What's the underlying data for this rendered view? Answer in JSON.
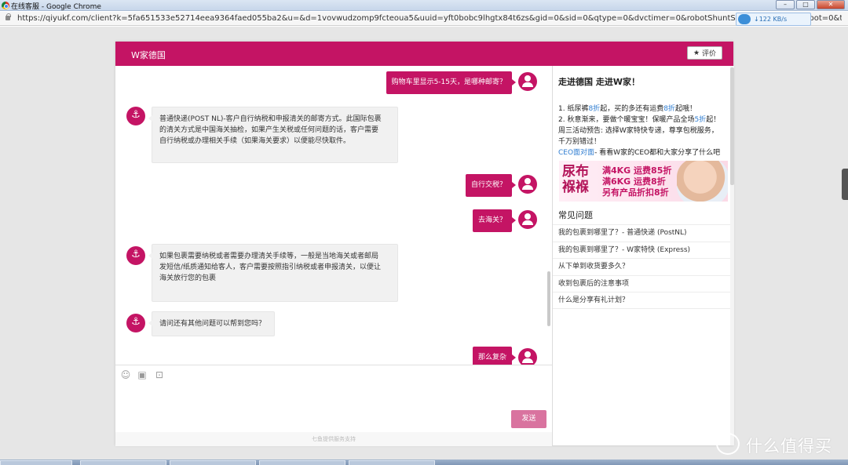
{
  "window": {
    "title": "在线客服 - Google Chrome"
  },
  "browser": {
    "url": "https://qiyukf.com/client?k=5fa651533e52714eea9364faed055ba2&u=&d=1vovwudzomp9fcteoua5&uuid=yft0bobc9lhgtx84t6zs&gid=0&sid=0&qtype=0&dvctimer=0&robotShuntSwitch=0&hc=0&robot=0&t=1540431...",
    "net_speed": "↓122 KB/s"
  },
  "header": {
    "brand": "W家德国",
    "rate_label": "评价"
  },
  "chat": {
    "messages": [
      {
        "from": "user",
        "text": "购物车里显示5-15天，是哪种邮寄？"
      },
      {
        "from": "agent",
        "lines": [
          "普通快递(POST NL)-客户自行纳税和申报清关的邮寄方式。此国际包裹",
          "的清关方式是中国海关抽检，如果产生关税或任何问题的话，客户需要",
          "自行纳税或办理相关手续（如果海关要求）以便能尽快取件。"
        ]
      },
      {
        "from": "user",
        "text": "自行交税？"
      },
      {
        "from": "user",
        "text": "去海关？"
      },
      {
        "from": "agent",
        "lines": [
          "如果包裹需要纳税或者需要办理清关手续等，一般是当地海关或者邮局",
          "发短信/纸质通知给客人，客户需要按照指引纳税或者申报清关，以便让",
          "海关放行您的包裹"
        ]
      },
      {
        "from": "agent",
        "lines": [
          "请问还有其他问题可以帮到您吗？"
        ]
      },
      {
        "from": "user",
        "text": "那么复杂"
      }
    ]
  },
  "input": {
    "send_label": "发送",
    "powered_by": "七鱼提供服务支持"
  },
  "panel": {
    "title": "走进德国 走进W家！",
    "promo": {
      "line1_a": "1. 纸尿裤",
      "line1_b": "8折",
      "line1_c": "起，买的多还有运费",
      "line1_d": "8折",
      "line1_e": "起哦！",
      "line2_a": "2. 秋意渐来，要做个暖宝宝！保暖产品全场",
      "line2_b": "5折",
      "line2_c": "起！",
      "line3": "周三活动预告: 选择W家特快专递，尊享包税服务，",
      "line4": "千万别错过！",
      "line5_a": "CEO面对面",
      "line5_b": "- 看看W家的CEO都和大家分享了什么吧"
    },
    "banner": {
      "big": "尿布褓褓",
      "l1": "满4KG 运费85折",
      "l2": "满6KG 运费8折",
      "l3": "另有产品折扣8折"
    },
    "faq_title": "常见问题",
    "faq": [
      "我的包裹到哪里了？- 普通快递 (PostNL)",
      "我的包裹到哪里了？- W家特快 (Express)",
      "从下单到收货要多久？",
      "收到包裹后的注意事项",
      "什么是分享有礼计划？"
    ]
  },
  "watermark": {
    "text": "什么值得买"
  },
  "colors": {
    "brand": "#c41464",
    "send": "#d9739f",
    "link": "#2f7dd1"
  }
}
